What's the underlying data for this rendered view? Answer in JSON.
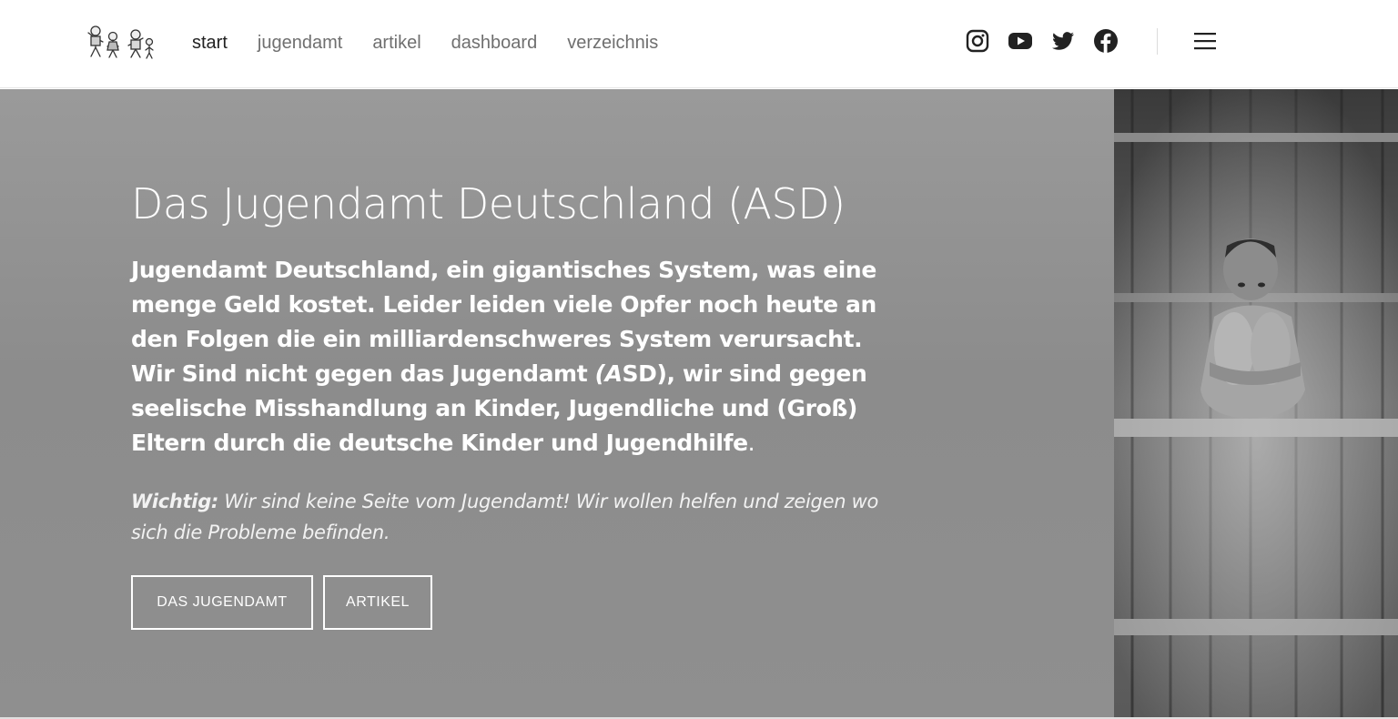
{
  "nav": {
    "items": [
      {
        "label": "start",
        "active": true
      },
      {
        "label": "jugendamt",
        "active": false
      },
      {
        "label": "artikel",
        "active": false
      },
      {
        "label": "dashboard",
        "active": false
      },
      {
        "label": "verzeichnis",
        "active": false
      }
    ]
  },
  "social": [
    "instagram-icon",
    "youtube-icon",
    "twitter-icon",
    "facebook-icon"
  ],
  "hero": {
    "title": "Das Jugendamt Deutschland (ASD)",
    "lead_part1": "Jugendamt Deutschland, ein gigantisches System, was eine menge Geld kostet. Leider leiden viele Opfer noch heute an den Folgen die ein milliardenschweres System verursacht. Wir Sind nicht gegen das Jugendamt ",
    "lead_italic": "(A",
    "lead_part2": "SD), wir sind gegen seelische Misshandlung an Kinder, Jugendliche und (Groß) Eltern durch die deutsche Kinder und Jugendhilfe",
    "lead_end": ".",
    "note_label": "Wichtig:",
    "note_text": " Wir sind keine Seite vom Jugendamt! Wir wollen helfen und zeigen wo sich die Probleme befinden.",
    "button_primary": "DAS JUGENDAMT",
    "button_secondary": "ARTIKEL"
  },
  "colors": {
    "hero_bg": "#8f8f8f",
    "nav_text": "#6f6f6f",
    "nav_active": "#222222"
  }
}
